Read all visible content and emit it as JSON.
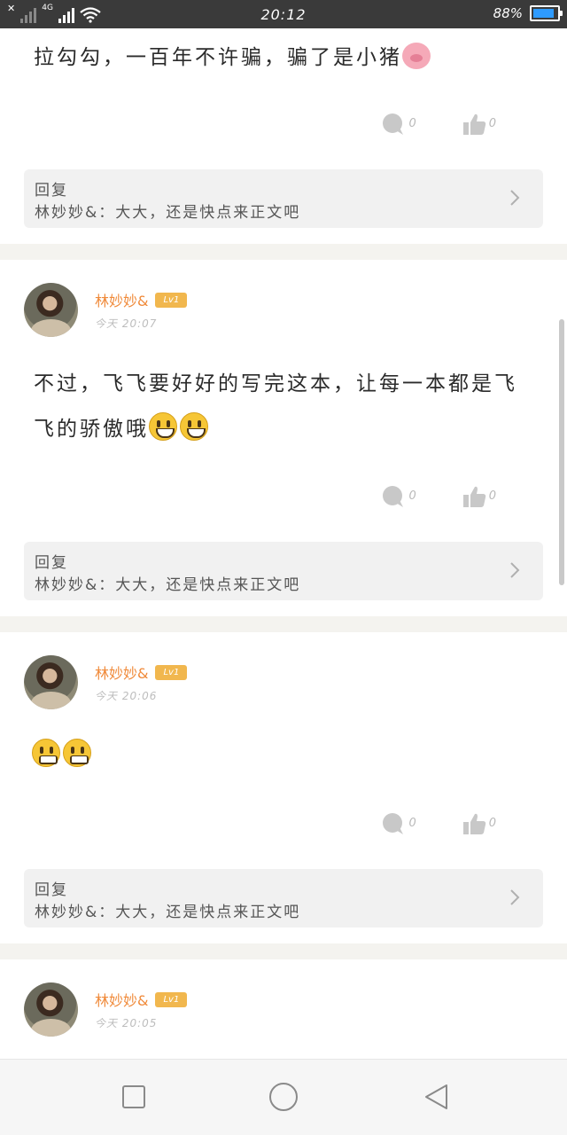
{
  "status_bar": {
    "network": "4G",
    "time": "20:12",
    "battery": "88%",
    "battery_level": 0.88,
    "icons": [
      "signal-off-icon",
      "signal-icon",
      "wifi-icon",
      "battery-icon"
    ]
  },
  "colors": {
    "name": "#f08a3a",
    "level_badge": "#f1b74e",
    "battery_fill": "#2e9bff"
  },
  "posts": [
    {
      "content": "拉勾勾，一百年不许骗，骗了是小猪",
      "content_emoji": "pig-emoji",
      "comments_count": "0",
      "likes_count": "0",
      "reply_label": "回复",
      "reply_text": "林妙妙&：大大，还是快点来正文吧"
    },
    {
      "author": "林妙妙&",
      "level": "Lv1",
      "time": "今天 20:07",
      "content": "不过，飞飞要好好的写完这本，让每一本都是飞飞的骄傲哦",
      "content_emoji": "smile-emoji x2",
      "comments_count": "0",
      "likes_count": "0",
      "reply_label": "回复",
      "reply_text": "林妙妙&：大大，还是快点来正文吧"
    },
    {
      "author": "林妙妙&",
      "level": "Lv1",
      "time": "今天 20:06",
      "content": "",
      "content_emoji": "grin-emoji x2",
      "comments_count": "0",
      "likes_count": "0",
      "reply_label": "回复",
      "reply_text": "林妙妙&：大大，还是快点来正文吧"
    },
    {
      "author": "林妙妙&",
      "level": "Lv1",
      "time": "今天 20:05"
    }
  ],
  "nav_bar": {
    "buttons": [
      "recent-apps-icon",
      "home-icon",
      "back-icon"
    ]
  }
}
